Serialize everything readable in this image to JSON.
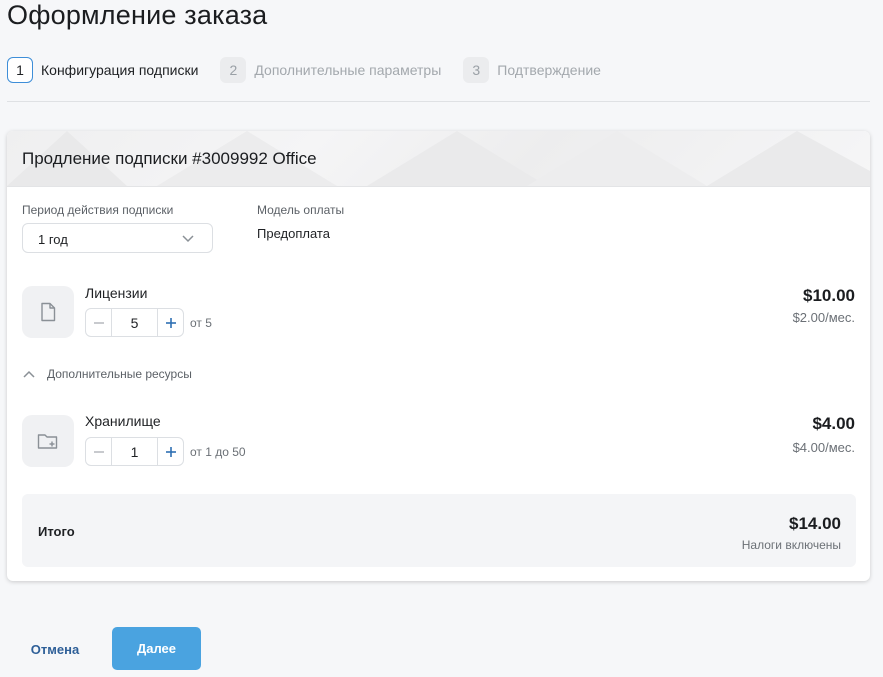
{
  "page": {
    "title": "Оформление заказа"
  },
  "steps": [
    {
      "number": "1",
      "label": "Конфигурация подписки",
      "state": "active"
    },
    {
      "number": "2",
      "label": "Дополнительные параметры",
      "state": "inactive"
    },
    {
      "number": "3",
      "label": "Подтверждение",
      "state": "inactive"
    }
  ],
  "card": {
    "title": "Продление подписки #3009992 Office",
    "period": {
      "label": "Период действия подписки",
      "value": "1 год"
    },
    "payment_model": {
      "label": "Модель оплаты",
      "value": "Предоплата"
    },
    "licenses": {
      "title": "Лицензии",
      "icon": "document-icon",
      "quantity": "5",
      "hint": "от 5",
      "price": "$10.00",
      "unit_price": "$2.00/мес."
    },
    "extra_resources": {
      "label": "Дополнительные ресурсы",
      "expanded": true
    },
    "storage": {
      "title": "Хранилище",
      "icon": "folder-add-icon",
      "quantity": "1",
      "hint": "от 1 до 50",
      "price": "$4.00",
      "unit_price": "$4.00/мес."
    },
    "total": {
      "label": "Итого",
      "value": "$14.00",
      "note": "Налоги включены"
    }
  },
  "actions": {
    "cancel": "Отмена",
    "next": "Далее"
  },
  "colors": {
    "accent": "#4aa3e0",
    "link": "#2e5f98",
    "active_step_border": "#3e8ed8"
  }
}
